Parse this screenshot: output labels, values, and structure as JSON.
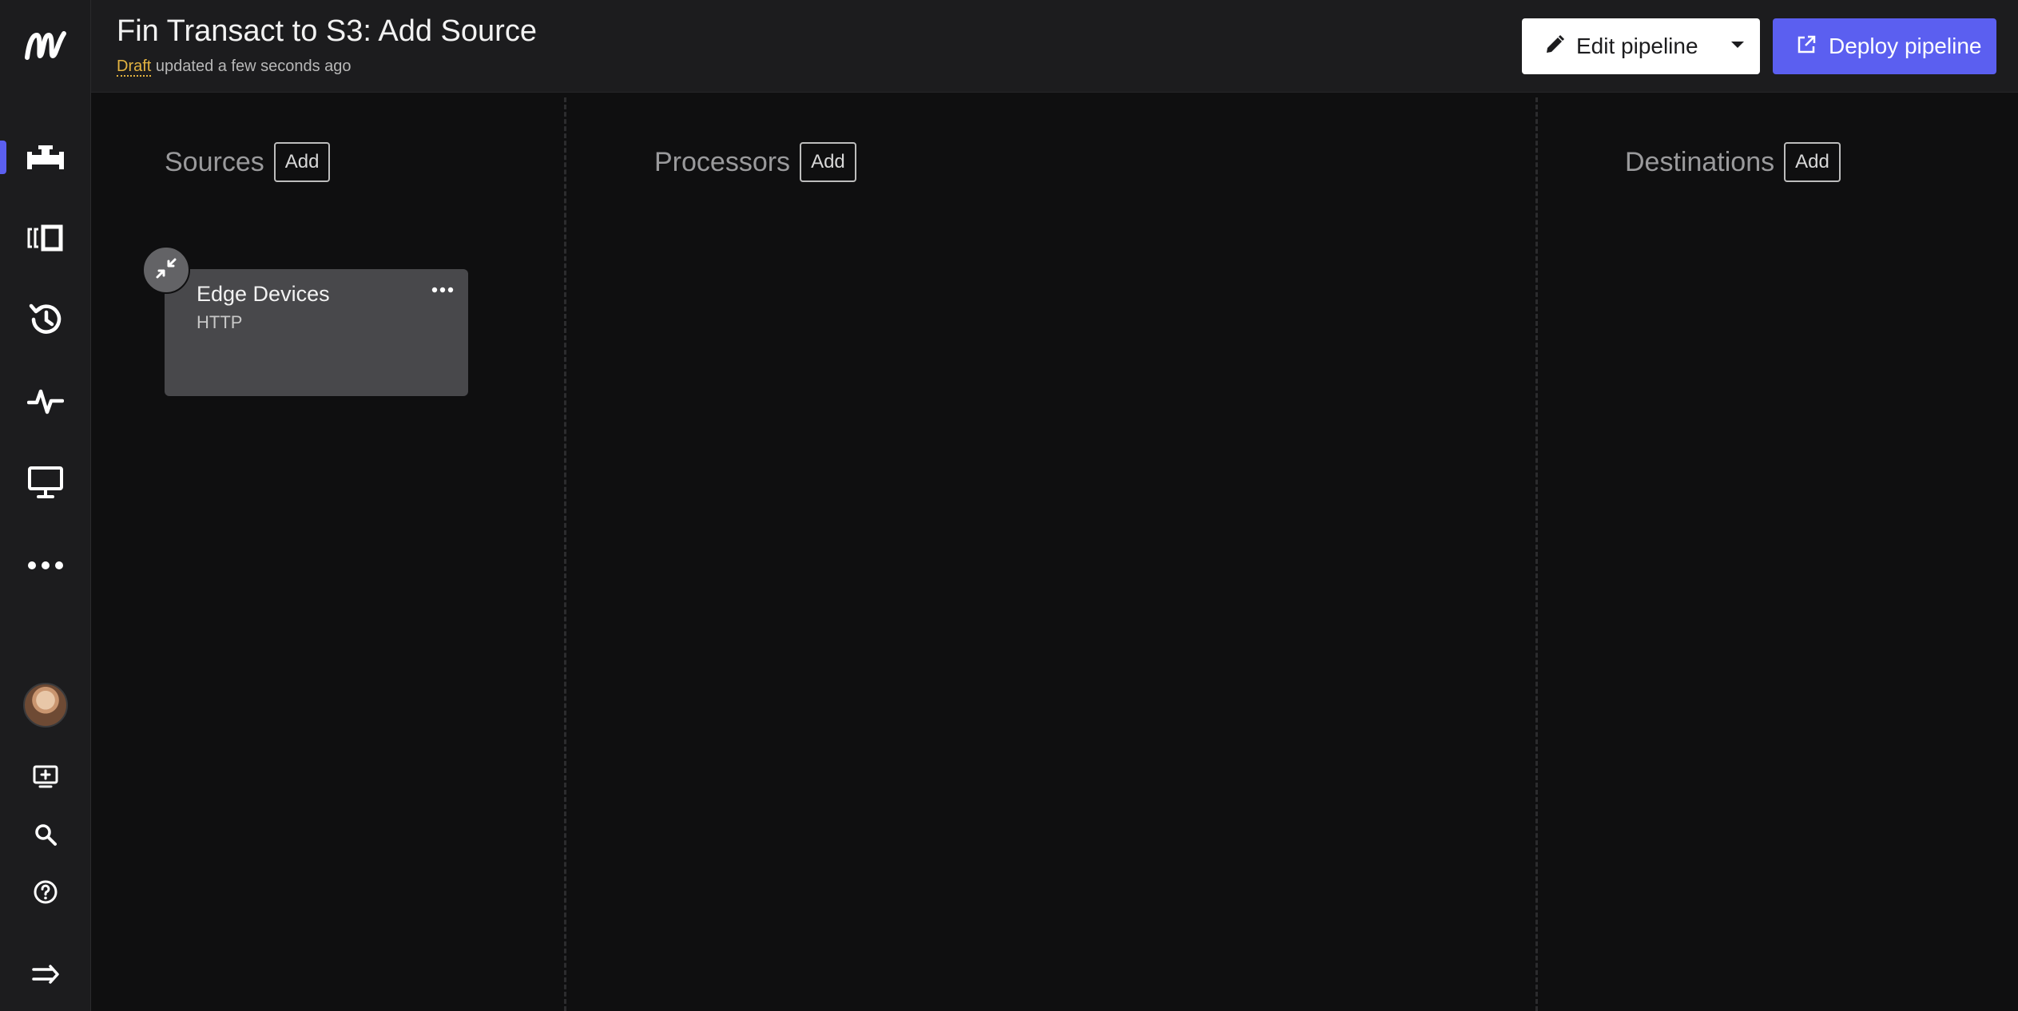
{
  "header": {
    "title": "Fin Transact to S3: Add Source",
    "status": "Draft",
    "updated_text": " updated a few seconds ago",
    "edit_label": "Edit pipeline",
    "deploy_label": "Deploy pipeline"
  },
  "sidebar": {
    "items": [
      {
        "icon": "pipeline-icon",
        "active": true
      },
      {
        "icon": "frames-icon"
      },
      {
        "icon": "history-icon"
      },
      {
        "icon": "activity-icon"
      },
      {
        "icon": "monitor-icon"
      },
      {
        "icon": "more-icon"
      }
    ],
    "bottom": [
      "avatar",
      "add-screen-icon",
      "search-icon",
      "help-icon",
      "expand-icon"
    ]
  },
  "canvas": {
    "columns": [
      {
        "name": "Sources",
        "add_label": "Add"
      },
      {
        "name": "Processors",
        "add_label": "Add"
      },
      {
        "name": "Destinations",
        "add_label": "Add"
      }
    ],
    "source_card": {
      "name": "Edge Devices",
      "type": "HTTP"
    },
    "zoom_controls": [
      "zoom-in-icon",
      "zoom-out-icon",
      "reset-icon"
    ]
  },
  "colors": {
    "accent": "#5b5ff0",
    "draft": "#e3b341",
    "card": "#48484b"
  }
}
